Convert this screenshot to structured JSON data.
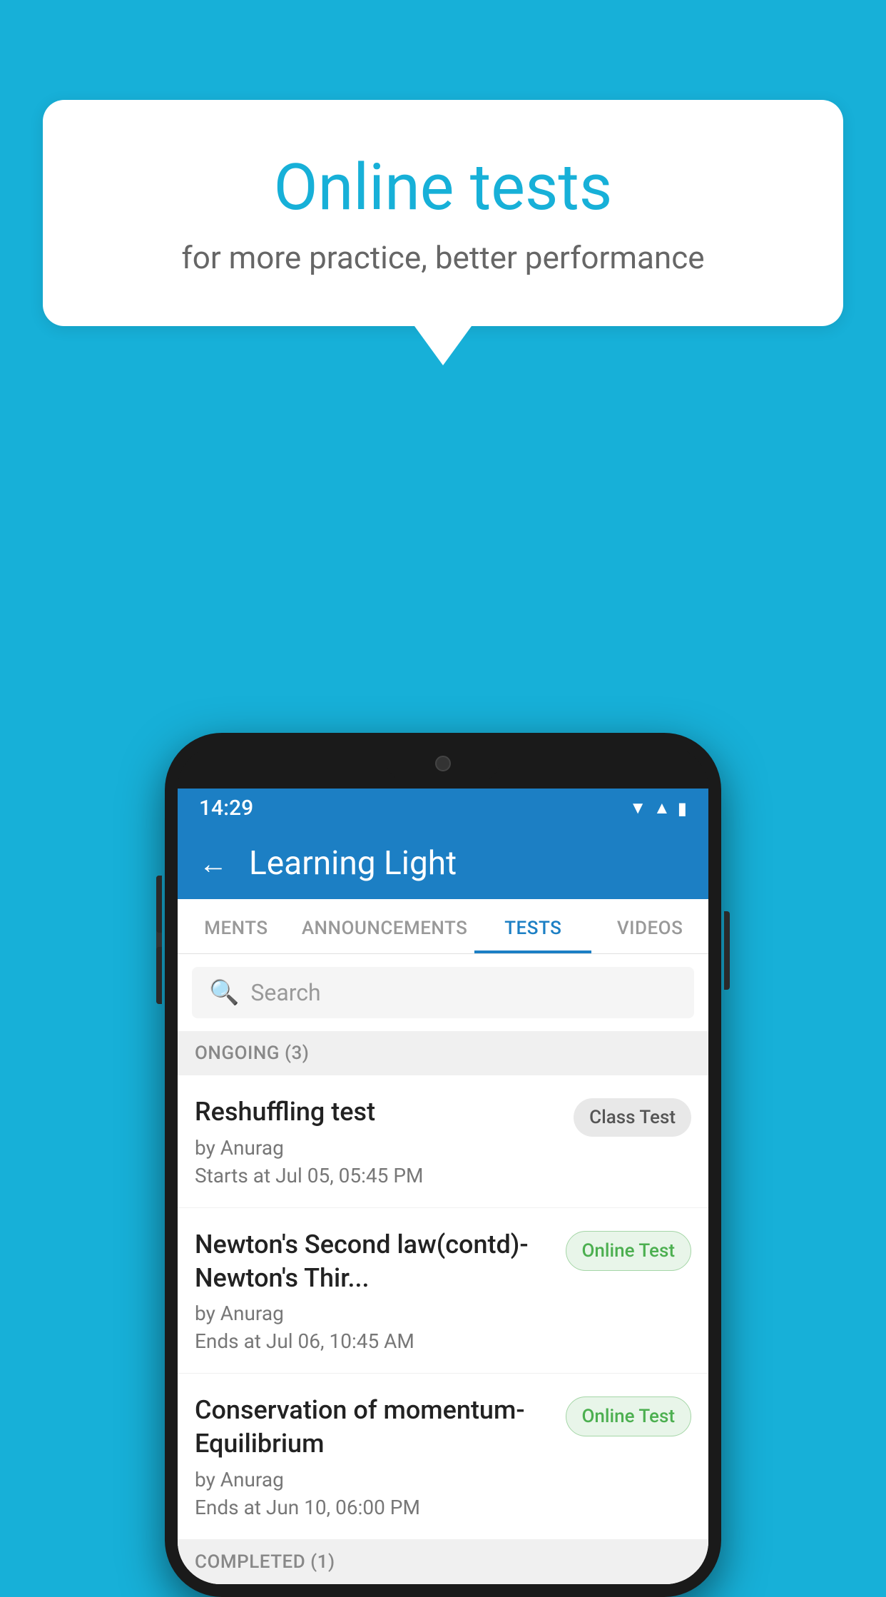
{
  "background_color": "#17b0d8",
  "speech_bubble": {
    "title": "Online tests",
    "subtitle": "for more practice, better performance"
  },
  "app": {
    "header": {
      "title": "Learning Light",
      "back_label": "←"
    },
    "status_bar": {
      "time": "14:29",
      "icons": [
        "wifi",
        "signal",
        "battery"
      ]
    },
    "tabs": [
      {
        "label": "MENTS",
        "active": false
      },
      {
        "label": "ANNOUNCEMENTS",
        "active": false
      },
      {
        "label": "TESTS",
        "active": true
      },
      {
        "label": "VIDEOS",
        "active": false
      }
    ],
    "search": {
      "placeholder": "Search"
    },
    "sections": [
      {
        "label": "ONGOING (3)",
        "items": [
          {
            "name": "Reshuffling test",
            "author": "by Anurag",
            "time_label": "Starts at  Jul 05, 05:45 PM",
            "badge": "Class Test",
            "badge_type": "class"
          },
          {
            "name": "Newton's Second law(contd)-Newton's Thir...",
            "author": "by Anurag",
            "time_label": "Ends at  Jul 06, 10:45 AM",
            "badge": "Online Test",
            "badge_type": "online"
          },
          {
            "name": "Conservation of momentum-Equilibrium",
            "author": "by Anurag",
            "time_label": "Ends at  Jun 10, 06:00 PM",
            "badge": "Online Test",
            "badge_type": "online"
          }
        ]
      }
    ],
    "completed_label": "COMPLETED (1)"
  }
}
